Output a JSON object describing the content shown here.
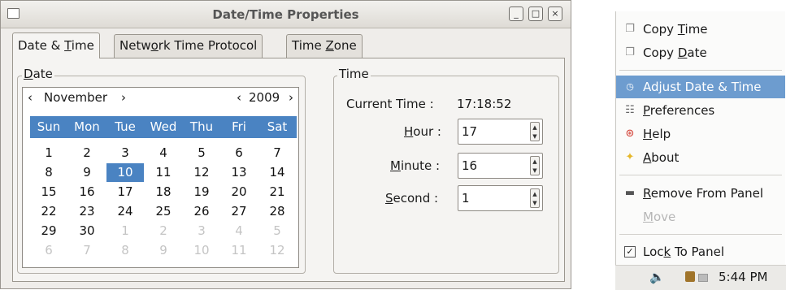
{
  "window": {
    "title": "Date/Time Properties",
    "controls": {
      "minimize": "_",
      "maximize": "□",
      "close": "×"
    }
  },
  "tabs": [
    {
      "label_pre": "Date & ",
      "label_u": "T",
      "label_post": "ime",
      "active": true
    },
    {
      "label_pre": "Netw",
      "label_u": "o",
      "label_post": "rk Time Protocol",
      "active": false
    },
    {
      "label_pre": "Time ",
      "label_u": "Z",
      "label_post": "one",
      "active": false
    }
  ],
  "date_frame": {
    "label_u": "D",
    "label_post": "ate",
    "month": "November",
    "year": "2009",
    "prev": "‹",
    "next": "›"
  },
  "calendar": {
    "weekdays": [
      "Sun",
      "Mon",
      "Tue",
      "Wed",
      "Thu",
      "Fri",
      "Sat"
    ],
    "rows": [
      [
        "1",
        "2",
        "3",
        "4",
        "5",
        "6",
        "7"
      ],
      [
        "8",
        "9",
        "10",
        "11",
        "12",
        "13",
        "14"
      ],
      [
        "15",
        "16",
        "17",
        "18",
        "19",
        "20",
        "21"
      ],
      [
        "22",
        "23",
        "24",
        "25",
        "26",
        "27",
        "28"
      ],
      [
        "29",
        "30",
        "1",
        "2",
        "3",
        "4",
        "5"
      ],
      [
        "6",
        "7",
        "8",
        "9",
        "10",
        "11",
        "12"
      ]
    ],
    "selected_day": "10"
  },
  "time_frame": {
    "label": "Time",
    "current_time_label": "Current Time :",
    "current_time_value": "17:18:52",
    "hour": {
      "label_u": "H",
      "label_post": "our :",
      "value": "17"
    },
    "minute": {
      "label_u": "M",
      "label_post": "inute :",
      "value": "16"
    },
    "second": {
      "label_u": "S",
      "label_post": "econd :",
      "value": "1"
    }
  },
  "context_menu": {
    "items": [
      {
        "icon": "copy-icon",
        "pre": "Copy ",
        "u": "T",
        "post": "ime"
      },
      {
        "icon": "copy-icon",
        "pre": "Copy ",
        "u": "D",
        "post": "ate"
      },
      {
        "icon": "clock-icon",
        "pre": "Adjust Date & Time",
        "u": "",
        "post": "",
        "highlighted": true
      },
      {
        "icon": "preferences-icon",
        "pre": "",
        "u": "P",
        "post": "references"
      },
      {
        "icon": "help-icon",
        "pre": "",
        "u": "H",
        "post": "elp"
      },
      {
        "icon": "about-icon",
        "pre": "",
        "u": "A",
        "post": "bout"
      },
      {
        "icon": "remove-icon",
        "pre": "",
        "u": "R",
        "post": "emove From Panel"
      },
      {
        "icon": "",
        "pre": "",
        "u": "M",
        "post": "ove",
        "disabled": true
      },
      {
        "icon": "checkbox-icon",
        "pre": "Loc",
        "u": "k",
        "post": " To Panel"
      }
    ]
  },
  "panel": {
    "clock": "5:44 PM"
  },
  "colors": {
    "selection": "#4a83c2",
    "menu_highlight": "#6d9ccf"
  }
}
